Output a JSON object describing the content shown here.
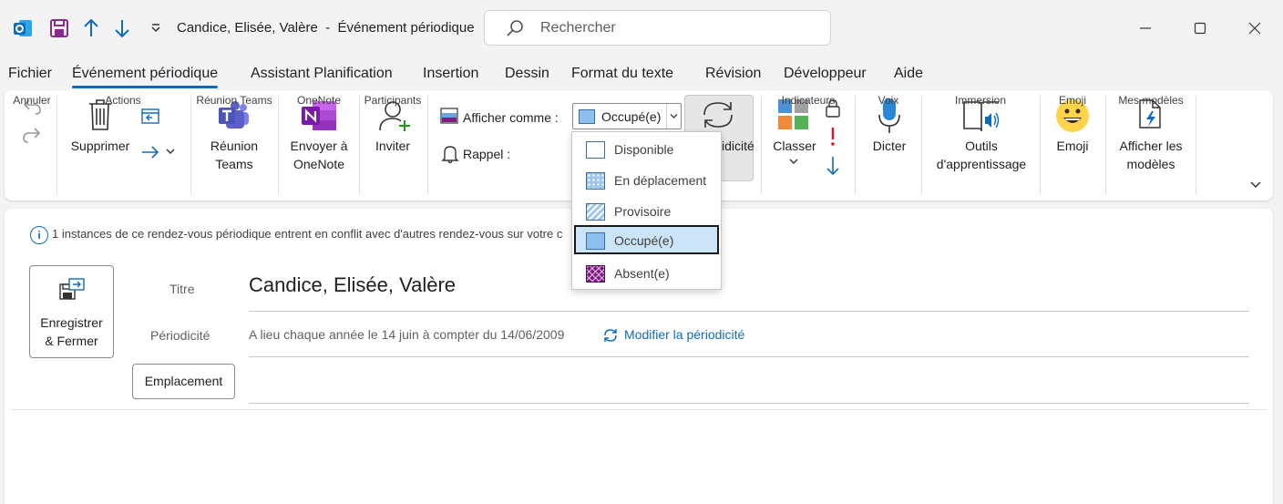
{
  "window": {
    "title": "Candice, Elisée, Valère  -  Événement périodique",
    "search_placeholder": "Rechercher"
  },
  "tabs": [
    "Fichier",
    "Événement périodique",
    "Assistant Planification",
    "Insertion",
    "Dessin",
    "Format du texte",
    "Révision",
    "Développeur",
    "Aide"
  ],
  "ribbon": {
    "groups": {
      "annuler": "Annuler",
      "actions": "Actions",
      "reunion_teams": "Réunion Teams",
      "onenote": "OneNote",
      "participants": "Participants",
      "indicateurs": "Indicateurs",
      "voix": "Voix",
      "immersion": "Immersion",
      "emoji": "Emoji",
      "mes_modeles": "Mes modèles"
    },
    "buttons": {
      "supprimer": "Supprimer",
      "reunion_line1": "Réunion",
      "reunion_line2": "Teams",
      "onenote_line1": "Envoyer à",
      "onenote_line2": "OneNote",
      "inviter": "Inviter",
      "classer": "Classer",
      "dicter": "Dicter",
      "outils_line1": "Outils",
      "outils_line2": "d'apprentissage",
      "emoji": "Emoji",
      "modeles_line1": "Afficher les",
      "modeles_line2": "modèles",
      "periodicite_partial": "idicité"
    },
    "afficher_comme_label": "Afficher comme :",
    "afficher_comme_value": "Occupé(e)",
    "rappel_label": "Rappel :"
  },
  "dropdown": {
    "options": [
      "Disponible",
      "En déplacement",
      "Provisoire",
      "Occupé(e)",
      "Absent(e)"
    ],
    "selected": "Occupé(e)"
  },
  "form": {
    "info_text": "1 instances de ce rendez-vous périodique entrent en conflit avec d'autres rendez-vous sur votre c",
    "save_line1": "Enregistrer",
    "save_line2": "& Fermer",
    "titre_label": "Titre",
    "titre_value": "Candice, Elisée, Valère",
    "periodicite_label": "Périodicité",
    "periodicite_value": "A lieu chaque année le 14 juin à compter du 14/06/2009",
    "modifier_link": "Modifier la périodicité",
    "emplacement_button": "Emplacement"
  },
  "colors": {
    "accent": "#0f6cbd",
    "busy": "#8fbfee",
    "away": "#7a1f7e",
    "outlook": "#0f6cbd",
    "teams": "#5b5fc7",
    "onenote": "#7719aa"
  }
}
